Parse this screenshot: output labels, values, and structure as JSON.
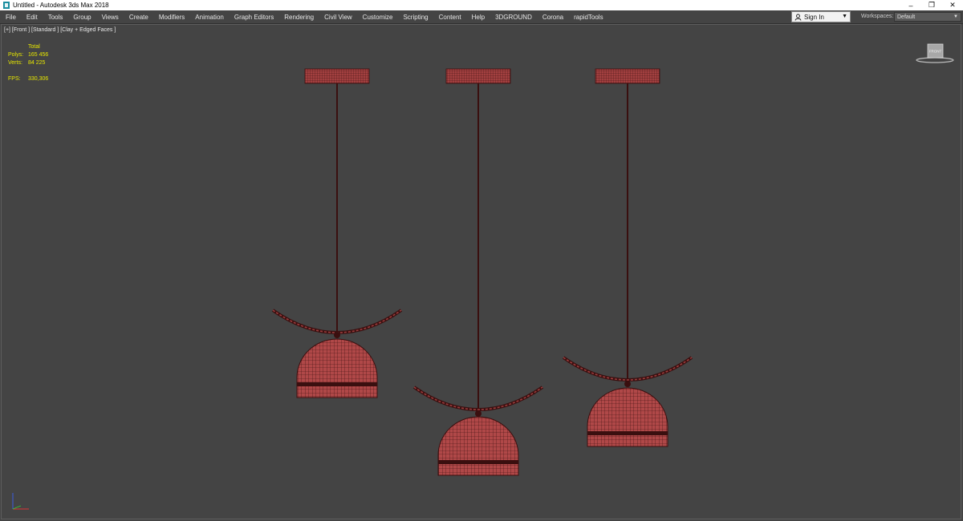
{
  "window": {
    "title": "Untitled - Autodesk 3ds Max 2018",
    "controls": {
      "minimize": "–",
      "restore": "❐",
      "close": "✕"
    }
  },
  "menu": {
    "items": [
      "File",
      "Edit",
      "Tools",
      "Group",
      "Views",
      "Create",
      "Modifiers",
      "Animation",
      "Graph Editors",
      "Rendering",
      "Civil View",
      "Customize",
      "Scripting",
      "Content",
      "Help",
      "3DGROUND",
      "Corona",
      "rapidTools"
    ]
  },
  "account": {
    "signin_label": "Sign In",
    "workspaces_label": "Workspaces:",
    "workspace_value": "Default"
  },
  "viewport": {
    "label": "[+] [Front ] [Standard ] [Clay + Edged Faces ]",
    "stats": {
      "total_label": "Total",
      "polys_label": "Polys:",
      "polys_value": "165 456",
      "verts_label": "Verts:",
      "verts_value": "84 225",
      "fps_label": "FPS:",
      "fps_value": "330,306"
    },
    "viewcube_label": "FRONT"
  },
  "colors": {
    "viewport_bg": "#444444",
    "mesh_fill": "#b04848",
    "mesh_wire": "#3a0f0f",
    "stats_text": "#e6e600"
  }
}
